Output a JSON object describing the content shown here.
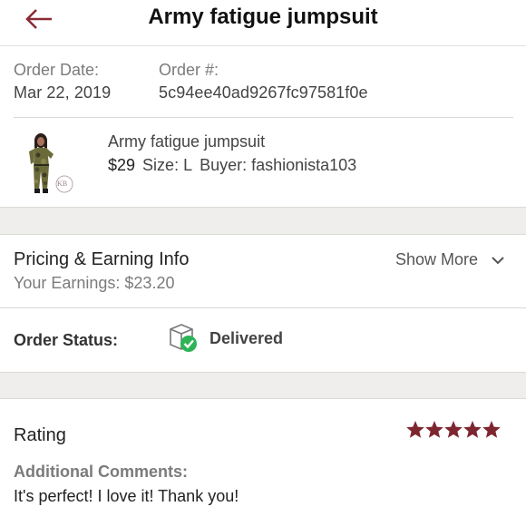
{
  "header": {
    "title": "Army fatigue jumpsuit",
    "accent_color": "#8a2a33"
  },
  "order": {
    "date_label": "Order Date:",
    "date_value": "Mar 22, 2019",
    "number_label": "Order #:",
    "number_value": "5c94ee40ad9267fc97581f0e"
  },
  "item": {
    "name": "Army fatigue jumpsuit",
    "price": "$29",
    "size": "Size: L",
    "buyer": "Buyer: fashionista103",
    "thumbnail_watermark": "KB"
  },
  "pricing": {
    "title": "Pricing & Earning Info",
    "earnings": "Your Earnings: $23.20",
    "show_more": "Show More"
  },
  "status": {
    "label": "Order Status:",
    "value": "Delivered",
    "icon": "box-check-icon",
    "check_color": "#2db457"
  },
  "rating": {
    "label": "Rating",
    "stars": 5,
    "max_stars": 5,
    "star_color": "#7e2630",
    "comments_label": "Additional Comments:",
    "comments": "It's perfect! I love it! Thank you!"
  }
}
